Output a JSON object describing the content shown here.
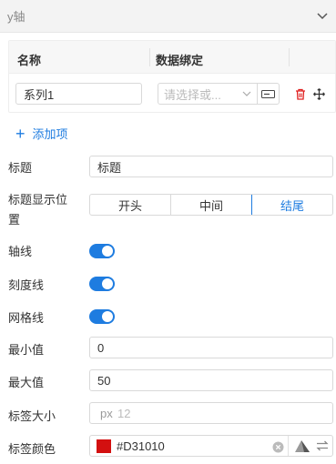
{
  "section": {
    "title": "y轴"
  },
  "series_table": {
    "headers": [
      "名称",
      "数据绑定"
    ],
    "rows": [
      {
        "name": "系列1",
        "binding_placeholder": "请选择或..."
      }
    ]
  },
  "add_item_label": "添加项",
  "fields": {
    "title": {
      "label": "标题",
      "value": "标题"
    },
    "title_position": {
      "label_line1": "标题显示位",
      "label_line2": "置",
      "options": [
        "开头",
        "中间",
        "结尾"
      ],
      "selected": "结尾"
    },
    "axis_line": {
      "label": "轴线",
      "on": true
    },
    "tick_line": {
      "label": "刻度线",
      "on": true
    },
    "grid_line": {
      "label": "网格线",
      "on": true
    },
    "min": {
      "label": "最小值",
      "value": "0"
    },
    "max": {
      "label": "最大值",
      "value": "50"
    },
    "label_size": {
      "label": "标签大小",
      "prefix": "px",
      "placeholder": "12"
    },
    "label_color": {
      "label": "标签颜色",
      "value": "#D31010",
      "swatch": "#d31010"
    }
  },
  "colors": {
    "accent": "#1e7ce0",
    "danger": "#e02020"
  }
}
